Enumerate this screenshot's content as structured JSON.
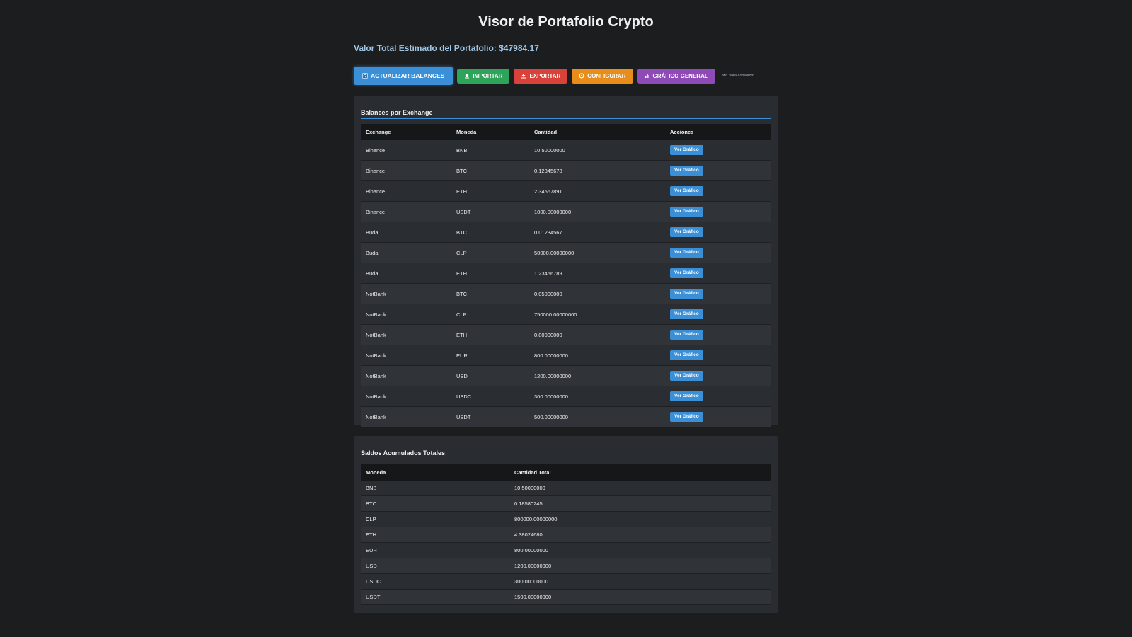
{
  "header": {
    "title": "Visor de Portafolio Crypto",
    "total_label": "Valor Total Estimado del Portafolio: $47984.17"
  },
  "toolbar": {
    "refresh_label": "ACTUALIZAR BALANCES",
    "import_label": "IMPORTAR",
    "export_label": "EXPORTAR",
    "config_label": "CONFIGURAR",
    "chart_label": "GRÁFICO GENERAL",
    "status": "Listo para actualizar"
  },
  "balances": {
    "title": "Balances por Exchange",
    "columns": [
      "Exchange",
      "Moneda",
      "Cantidad",
      "Acciones"
    ],
    "action_label": "Ver Gráfico",
    "rows": [
      {
        "exchange": "Binance",
        "coin": "BNB",
        "amount": "10.50000000"
      },
      {
        "exchange": "Binance",
        "coin": "BTC",
        "amount": "0.12345678"
      },
      {
        "exchange": "Binance",
        "coin": "ETH",
        "amount": "2.34567891"
      },
      {
        "exchange": "Binance",
        "coin": "USDT",
        "amount": "1000.00000000"
      },
      {
        "exchange": "Buda",
        "coin": "BTC",
        "amount": "0.01234567"
      },
      {
        "exchange": "Buda",
        "coin": "CLP",
        "amount": "50000.00000000"
      },
      {
        "exchange": "Buda",
        "coin": "ETH",
        "amount": "1.23456789"
      },
      {
        "exchange": "NotBank",
        "coin": "BTC",
        "amount": "0.05000000"
      },
      {
        "exchange": "NotBank",
        "coin": "CLP",
        "amount": "750000.00000000"
      },
      {
        "exchange": "NotBank",
        "coin": "ETH",
        "amount": "0.80000000"
      },
      {
        "exchange": "NotBank",
        "coin": "EUR",
        "amount": "800.00000000"
      },
      {
        "exchange": "NotBank",
        "coin": "USD",
        "amount": "1200.00000000"
      },
      {
        "exchange": "NotBank",
        "coin": "USDC",
        "amount": "300.00000000"
      },
      {
        "exchange": "NotBank",
        "coin": "USDT",
        "amount": "500.00000000"
      }
    ]
  },
  "totals": {
    "title": "Saldos Acumulados Totales",
    "columns": [
      "Moneda",
      "Cantidad Total"
    ],
    "rows": [
      {
        "coin": "BNB",
        "amount": "10.50000000"
      },
      {
        "coin": "BTC",
        "amount": "0.18580245"
      },
      {
        "coin": "CLP",
        "amount": "800000.00000000"
      },
      {
        "coin": "ETH",
        "amount": "4.38024680"
      },
      {
        "coin": "EUR",
        "amount": "800.00000000"
      },
      {
        "coin": "USD",
        "amount": "1200.00000000"
      },
      {
        "coin": "USDC",
        "amount": "300.00000000"
      },
      {
        "coin": "USDT",
        "amount": "1500.00000000"
      }
    ]
  },
  "icons": {
    "refresh": "refresh-icon",
    "import": "upload-icon",
    "export": "download-icon",
    "config": "gear-icon",
    "chart": "chart-icon"
  }
}
